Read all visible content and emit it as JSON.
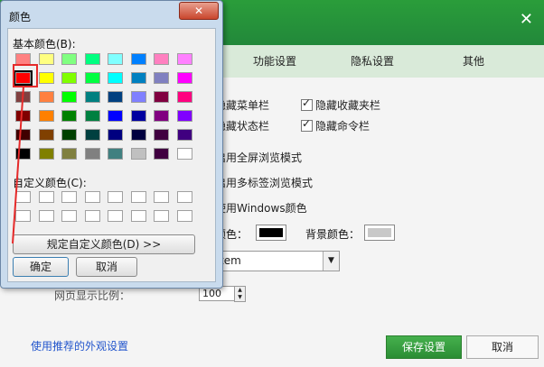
{
  "settings": {
    "close_glyph": "✕",
    "tabs": [
      "功能设置",
      "隐私设置",
      "其他"
    ],
    "options": [
      {
        "label": "隐藏菜单栏",
        "checked": false
      },
      {
        "label": "隐藏收藏夹栏",
        "checked": true
      },
      {
        "label": "隐藏状态栏",
        "checked": false
      },
      {
        "label": "隐藏命令栏",
        "checked": true
      },
      {
        "label": "启用全屏浏览模式",
        "checked": false
      },
      {
        "label": "启用多标签浏览模式",
        "checked": false
      },
      {
        "label": "使用Windows颜色",
        "checked": false
      }
    ],
    "text_color_label": "颜色：",
    "bg_color_label": "背景颜色：",
    "text_color": "#000000",
    "bg_color": "#c8c8c8",
    "font_value": "tem",
    "zoom_label": "网页显示比例：",
    "zoom_value": "100",
    "recommend_link": "使用推荐的外观设置",
    "save_label": "保存设置",
    "cancel_label": "取消"
  },
  "picker": {
    "title": "颜色",
    "close_glyph": "✕",
    "basic_label": "基本颜色(B):",
    "custom_label": "自定义颜色(C):",
    "define_label": "规定自定义颜色(D) >>",
    "ok_label": "确定",
    "cancel_label": "取消",
    "selected_index": 8,
    "basic_colors": [
      "#ff8080",
      "#ffff80",
      "#80ff80",
      "#00ff80",
      "#80ffff",
      "#0080ff",
      "#ff80c0",
      "#ff80ff",
      "#ff0000",
      "#ffff00",
      "#80ff00",
      "#00ff40",
      "#00ffff",
      "#0080c0",
      "#8080c0",
      "#ff00ff",
      "#804040",
      "#ff8040",
      "#00ff00",
      "#008080",
      "#004080",
      "#8080ff",
      "#800040",
      "#ff0080",
      "#800000",
      "#ff8000",
      "#008000",
      "#008040",
      "#0000ff",
      "#0000a0",
      "#800080",
      "#8000ff",
      "#400000",
      "#804000",
      "#004000",
      "#004040",
      "#000080",
      "#000040",
      "#400040",
      "#400080",
      "#000000",
      "#808000",
      "#808040",
      "#808080",
      "#408080",
      "#c0c0c0",
      "#400040",
      "#ffffff"
    ],
    "custom_colors": [
      "",
      "",
      "",
      "",
      "",
      "",
      "",
      "",
      "",
      "",
      "",
      "",
      "",
      "",
      "",
      ""
    ]
  }
}
